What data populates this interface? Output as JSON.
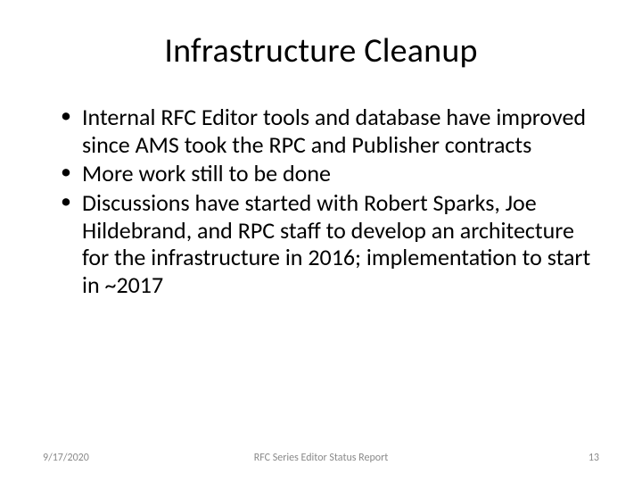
{
  "title": "Infrastructure Cleanup",
  "bullets": [
    "Internal RFC Editor tools and database have improved since AMS took the RPC and Publisher contracts",
    "More work still to be done",
    "Discussions have started with Robert Sparks, Joe Hildebrand, and RPC staff to develop an architecture for the infrastructure in 2016; implementation to start in ~2017"
  ],
  "footer": {
    "date": "9/17/2020",
    "center": "RFC Series Editor Status Report",
    "page": "13"
  }
}
